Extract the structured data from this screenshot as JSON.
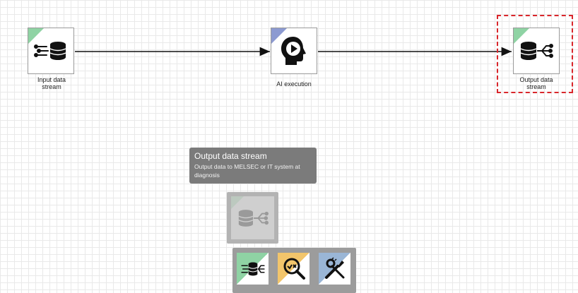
{
  "nodes": {
    "input": {
      "label_line1": "Input data",
      "label_line2": "stream"
    },
    "ai": {
      "label": "AI execution"
    },
    "output": {
      "label_line1": "Output data",
      "label_line2": "stream"
    }
  },
  "tooltip": {
    "title": "Output data stream",
    "description_line1": "Output data to MELSEC or IT system at",
    "description_line2": "diagnosis"
  },
  "palette": {
    "items": [
      {
        "icon": "data-stream-icon",
        "corner_color": "#8fd3a4"
      },
      {
        "icon": "magnifier-check-icon",
        "corner_color": "#f2c56b"
      },
      {
        "icon": "tools-icon",
        "corner_color": "#9ab6d6"
      }
    ]
  },
  "colors": {
    "data_corner": "#8fd3a4",
    "ai_corner": "#8c9ad1",
    "selection": "#d9262b",
    "tooltip_bg": "#7b7b7b"
  }
}
